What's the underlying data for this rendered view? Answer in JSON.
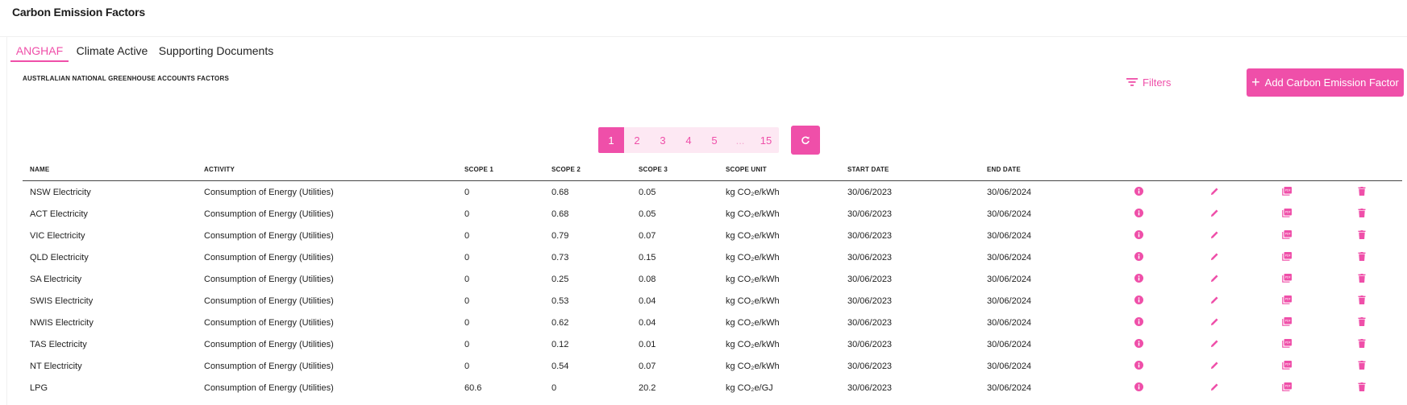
{
  "header": {
    "title": "Carbon Emission Factors"
  },
  "tabs": [
    {
      "label": "ANGHAF",
      "active": true
    },
    {
      "label": "Climate Active",
      "active": false
    },
    {
      "label": "Supporting Documents",
      "active": false
    }
  ],
  "section": {
    "title": "AUSTRLALIAN NATIONAL GREENHOUSE ACCOUNTS FACTORS"
  },
  "toolbar": {
    "filters_label": "Filters",
    "add_label": "Add Carbon Emission Factor"
  },
  "pagination": {
    "pages": [
      "1",
      "2",
      "3",
      "4",
      "5",
      "...",
      "15"
    ],
    "current": "1"
  },
  "colors": {
    "accent": "#ef4fa9",
    "accent_light": "#fde8f3"
  },
  "icons": [
    "info-icon",
    "edit-icon",
    "pdf-icon",
    "delete-icon",
    "filter-icon",
    "refresh-icon",
    "plus-icon"
  ],
  "table": {
    "columns": [
      "NAME",
      "ACTIVITY",
      "SCOPE 1",
      "SCOPE 2",
      "SCOPE 3",
      "SCOPE UNIT",
      "START DATE",
      "END DATE"
    ],
    "rows": [
      [
        "NSW Electricity",
        "Consumption of Energy (Utilities)",
        "0",
        "0.68",
        "0.05",
        "kg CO₂e/kWh",
        "30/06/2023",
        "30/06/2024"
      ],
      [
        "ACT Electricity",
        "Consumption of Energy (Utilities)",
        "0",
        "0.68",
        "0.05",
        "kg CO₂e/kWh",
        "30/06/2023",
        "30/06/2024"
      ],
      [
        "VIC Electricity",
        "Consumption of Energy (Utilities)",
        "0",
        "0.79",
        "0.07",
        "kg CO₂e/kWh",
        "30/06/2023",
        "30/06/2024"
      ],
      [
        "QLD Electricity",
        "Consumption of Energy (Utilities)",
        "0",
        "0.73",
        "0.15",
        "kg CO₂e/kWh",
        "30/06/2023",
        "30/06/2024"
      ],
      [
        "SA Electricity",
        "Consumption of Energy (Utilities)",
        "0",
        "0.25",
        "0.08",
        "kg CO₂e/kWh",
        "30/06/2023",
        "30/06/2024"
      ],
      [
        "SWIS Electricity",
        "Consumption of Energy (Utilities)",
        "0",
        "0.53",
        "0.04",
        "kg CO₂e/kWh",
        "30/06/2023",
        "30/06/2024"
      ],
      [
        "NWIS Electricity",
        "Consumption of Energy (Utilities)",
        "0",
        "0.62",
        "0.04",
        "kg CO₂e/kWh",
        "30/06/2023",
        "30/06/2024"
      ],
      [
        "TAS Electricity",
        "Consumption of Energy (Utilities)",
        "0",
        "0.12",
        "0.01",
        "kg CO₂e/kWh",
        "30/06/2023",
        "30/06/2024"
      ],
      [
        "NT Electricity",
        "Consumption of Energy (Utilities)",
        "0",
        "0.54",
        "0.07",
        "kg CO₂e/kWh",
        "30/06/2023",
        "30/06/2024"
      ],
      [
        "LPG",
        "Consumption of Energy (Utilities)",
        "60.6",
        "0",
        "20.2",
        "kg CO₂e/GJ",
        "30/06/2023",
        "30/06/2024"
      ]
    ]
  }
}
